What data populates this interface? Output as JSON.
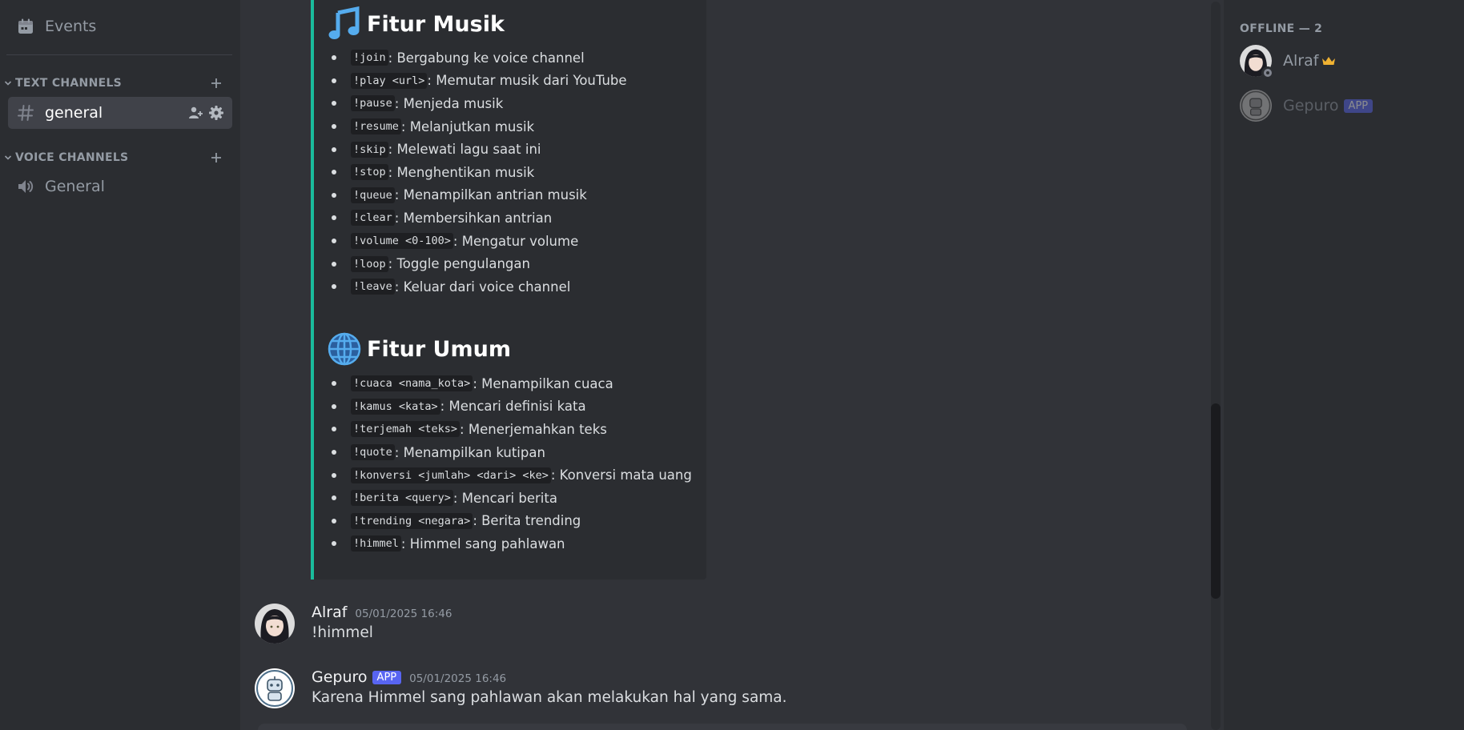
{
  "sidebar": {
    "events_label": "Events",
    "text_category": "TEXT CHANNELS",
    "voice_category": "VOICE CHANNELS",
    "text_channels": [
      {
        "name": "general"
      }
    ],
    "voice_channels": [
      {
        "name": "General"
      }
    ]
  },
  "embed": {
    "music_title": "Fitur Musik",
    "music_commands": [
      {
        "cmd": "!join",
        "desc": ": Bergabung ke voice channel"
      },
      {
        "cmd": "!play <url>",
        "desc": ": Memutar musik dari YouTube"
      },
      {
        "cmd": "!pause",
        "desc": ": Menjeda musik"
      },
      {
        "cmd": "!resume",
        "desc": ": Melanjutkan musik"
      },
      {
        "cmd": "!skip",
        "desc": ": Melewati lagu saat ini"
      },
      {
        "cmd": "!stop",
        "desc": ": Menghentikan musik"
      },
      {
        "cmd": "!queue",
        "desc": ": Menampilkan antrian musik"
      },
      {
        "cmd": "!clear",
        "desc": ": Membersihkan antrian"
      },
      {
        "cmd": "!volume <0-100>",
        "desc": ": Mengatur volume"
      },
      {
        "cmd": "!loop",
        "desc": ": Toggle pengulangan"
      },
      {
        "cmd": "!leave",
        "desc": ": Keluar dari voice channel"
      }
    ],
    "general_title": "Fitur Umum",
    "general_commands": [
      {
        "cmd": "!cuaca <nama_kota>",
        "desc": ": Menampilkan cuaca"
      },
      {
        "cmd": "!kamus <kata>",
        "desc": ": Mencari definisi kata"
      },
      {
        "cmd": "!terjemah <teks>",
        "desc": ": Menerjemahkan teks"
      },
      {
        "cmd": "!quote",
        "desc": ": Menampilkan kutipan"
      },
      {
        "cmd": "!konversi <jumlah> <dari> <ke>",
        "desc": ": Konversi mata uang"
      },
      {
        "cmd": "!berita <query>",
        "desc": ": Mencari berita"
      },
      {
        "cmd": "!trending <negara>",
        "desc": ": Berita trending"
      },
      {
        "cmd": "!himmel",
        "desc": ": Himmel sang pahlawan"
      }
    ]
  },
  "messages": [
    {
      "author": "Alraf",
      "timestamp": "05/01/2025 16:46",
      "content": "!himmel"
    },
    {
      "author": "Gepuro",
      "badge": "APP",
      "timestamp": "05/01/2025 16:46",
      "content": "Karena Himmel sang pahlawan akan melakukan hal yang sama."
    }
  ],
  "members": {
    "section_title": "OFFLINE — 2",
    "list": [
      {
        "name": "Alraf",
        "owner": true
      },
      {
        "name": "Gepuro",
        "badge": "APP"
      }
    ]
  },
  "colors": {
    "accent": "#5865f2",
    "embed_border": "#1abc9c",
    "crown": "#f0b232"
  }
}
